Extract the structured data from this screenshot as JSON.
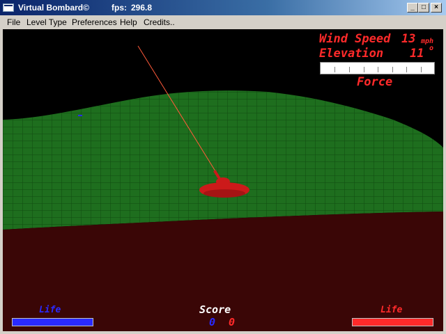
{
  "window": {
    "title": "Virtual Bombard©",
    "fps_label": "fps:",
    "fps_value": "296.8",
    "controls": {
      "minimize": "_",
      "maximize": "□",
      "close": "×"
    }
  },
  "menu": {
    "file": "File",
    "level_type": "Level Type",
    "preferences": "Preferences",
    "help": "Help",
    "credits": "Credits.."
  },
  "hud": {
    "wind_speed_label": "Wind Speed",
    "wind_speed_value": "13",
    "wind_speed_unit": "mph",
    "elevation_label": "Elevation",
    "elevation_value": "11",
    "elevation_unit": "o",
    "force_label": "Force",
    "force_level": 0,
    "left_life_label": "Life",
    "right_life_label": "Life",
    "left_life_level": 1.0,
    "right_life_level": 1.0,
    "score_label": "Score",
    "score_left": "0",
    "score_right": "0"
  },
  "colors": {
    "hud_red": "#ff2a2a",
    "hud_blue": "#2a2aff",
    "hill_green": "#1e6e1e",
    "ground_dark_red": "#3a0606",
    "tank_red": "#cc1a1a"
  }
}
